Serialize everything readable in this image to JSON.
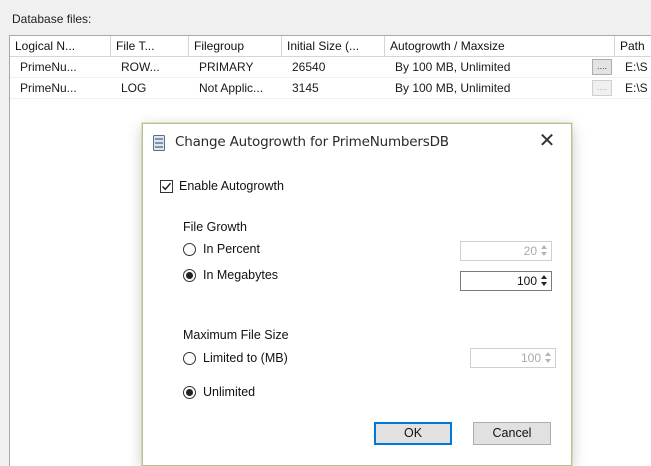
{
  "section": {
    "label": "Database files:"
  },
  "grid": {
    "columns": [
      "Logical N...",
      "File T...",
      "Filegroup",
      "Initial Size (...",
      "Autogrowth / Maxsize",
      "Path"
    ],
    "rows": [
      {
        "logical": "PrimeNu...",
        "filetype": "ROW...",
        "filegroup": "PRIMARY",
        "size": "26540",
        "autogrowth": "By 100 MB, Unlimited",
        "button": "....",
        "path": "E:\\S"
      },
      {
        "logical": "PrimeNu...",
        "filetype": "LOG",
        "filegroup": "Not Applic...",
        "size": "3145",
        "autogrowth": "By 100 MB, Unlimited",
        "button": "....",
        "path": "E:\\S"
      }
    ]
  },
  "dialog": {
    "title": "Change Autogrowth for PrimeNumbersDB",
    "close_glyph": "✕",
    "enable_autogrowth": {
      "label": "Enable Autogrowth",
      "checked": true,
      "checkmark": "✓"
    },
    "file_growth": {
      "heading": "File Growth",
      "in_percent": {
        "label": "In Percent",
        "selected": false,
        "value": "20"
      },
      "in_megabytes": {
        "label": "In Megabytes",
        "selected": true,
        "value": "100"
      }
    },
    "max_file_size": {
      "heading": "Maximum File Size",
      "limited": {
        "label": "Limited to (MB)",
        "selected": false,
        "value": "100"
      },
      "unlimited": {
        "label": "Unlimited",
        "selected": true
      }
    },
    "ok_label": "OK",
    "cancel_label": "Cancel"
  },
  "colors": {
    "dialog_border": "#b7c38f",
    "default_button_border": "#0078d7"
  }
}
